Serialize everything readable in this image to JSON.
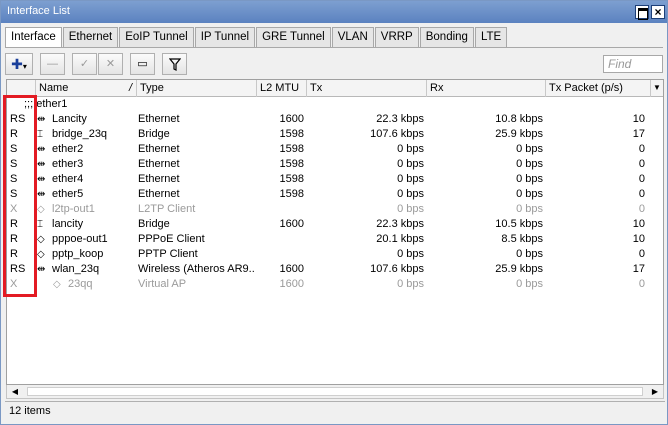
{
  "window": {
    "title": "Interface List",
    "close_glyph": "×"
  },
  "tabs": [
    "Interface",
    "Ethernet",
    "EoIP Tunnel",
    "IP Tunnel",
    "GRE Tunnel",
    "VLAN",
    "VRRP",
    "Bonding",
    "LTE"
  ],
  "active_tab": "Interface",
  "toolbar": {
    "add_glyph": "✚",
    "add_arrow": "▾",
    "remove_glyph": "—",
    "enable_glyph": "✓",
    "disable_glyph": "✕",
    "comment_glyph": "▭",
    "filter_glyph": "⏷",
    "find_placeholder": "Find"
  },
  "columns": {
    "name": "Name",
    "sort_glyph": "/",
    "type": "Type",
    "l2mtu": "L2 MTU",
    "tx": "Tx",
    "rx": "Rx",
    "tx_packet": "Tx Packet (p/s)",
    "dropdown_glyph": "▼"
  },
  "group_label": ";;; ether1",
  "rows": [
    {
      "flag": "RS",
      "icon": "⇹",
      "name": "Lancity",
      "type": "Ethernet",
      "l2mtu": "1600",
      "tx": "22.3 kbps",
      "rx": "10.8 kbps",
      "txp": "10",
      "disabled": false
    },
    {
      "flag": "R",
      "icon": "⌶",
      "name": "bridge_23q",
      "type": "Bridge",
      "l2mtu": "1598",
      "tx": "107.6 kbps",
      "rx": "25.9 kbps",
      "txp": "17",
      "disabled": false
    },
    {
      "flag": "S",
      "icon": "⇹",
      "name": "ether2",
      "type": "Ethernet",
      "l2mtu": "1598",
      "tx": "0 bps",
      "rx": "0 bps",
      "txp": "0",
      "disabled": false
    },
    {
      "flag": "S",
      "icon": "⇹",
      "name": "ether3",
      "type": "Ethernet",
      "l2mtu": "1598",
      "tx": "0 bps",
      "rx": "0 bps",
      "txp": "0",
      "disabled": false
    },
    {
      "flag": "S",
      "icon": "⇹",
      "name": "ether4",
      "type": "Ethernet",
      "l2mtu": "1598",
      "tx": "0 bps",
      "rx": "0 bps",
      "txp": "0",
      "disabled": false
    },
    {
      "flag": "S",
      "icon": "⇹",
      "name": "ether5",
      "type": "Ethernet",
      "l2mtu": "1598",
      "tx": "0 bps",
      "rx": "0 bps",
      "txp": "0",
      "disabled": false
    },
    {
      "flag": "X",
      "icon": "◇",
      "name": "l2tp-out1",
      "type": "L2TP Client",
      "l2mtu": "",
      "tx": "0 bps",
      "rx": "0 bps",
      "txp": "0",
      "disabled": true
    },
    {
      "flag": "R",
      "icon": "⌶",
      "name": "lancity",
      "type": "Bridge",
      "l2mtu": "1600",
      "tx": "22.3 kbps",
      "rx": "10.5 kbps",
      "txp": "10",
      "disabled": false
    },
    {
      "flag": "R",
      "icon": "◇",
      "name": "pppoe-out1",
      "type": "PPPoE Client",
      "l2mtu": "",
      "tx": "20.1 kbps",
      "rx": "8.5 kbps",
      "txp": "10",
      "disabled": false
    },
    {
      "flag": "R",
      "icon": "◇",
      "name": "pptp_koop",
      "type": "PPTP Client",
      "l2mtu": "",
      "tx": "0 bps",
      "rx": "0 bps",
      "txp": "0",
      "disabled": false
    },
    {
      "flag": "RS",
      "icon": "⇹",
      "name": "wlan_23q",
      "type": "Wireless (Atheros AR9...",
      "l2mtu": "1600",
      "tx": "107.6 kbps",
      "rx": "25.9 kbps",
      "txp": "17",
      "disabled": false
    },
    {
      "flag": "X",
      "icon": "◇",
      "name": "23qq",
      "type": "Virtual AP",
      "l2mtu": "1600",
      "tx": "0 bps",
      "rx": "0 bps",
      "txp": "0",
      "disabled": true
    }
  ],
  "scroll": {
    "left_glyph": "◀",
    "right_glyph": "▶"
  },
  "status": {
    "items": "12 items"
  },
  "highlight_color": "#e31b23"
}
